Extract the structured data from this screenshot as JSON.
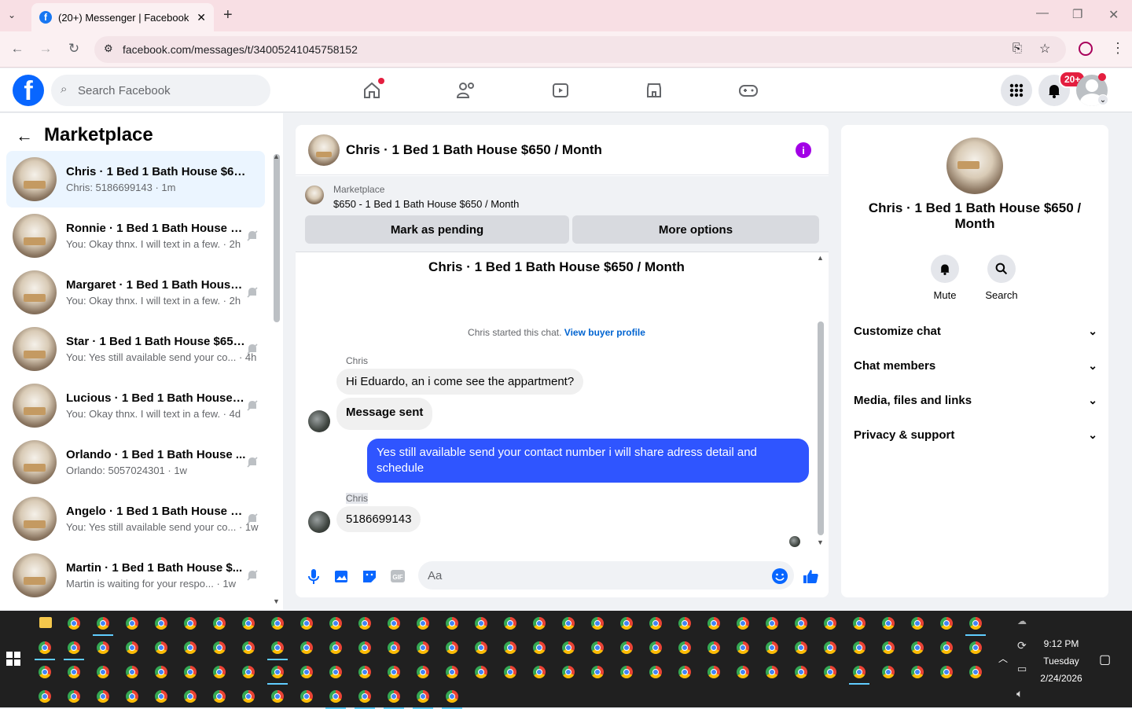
{
  "browser": {
    "tab_title": "(20+) Messenger | Facebook",
    "url": "facebook.com/messages/t/34005241045758152"
  },
  "fb": {
    "search_placeholder": "Search Facebook",
    "notif_badge": "20+"
  },
  "left": {
    "title": "Marketplace",
    "conversations": [
      {
        "name": "Chris · 1 Bed 1 Bath House $650 ...",
        "sub": "Chris: 5186699143 · 1m",
        "active": true
      },
      {
        "name": "Ronnie · 1 Bed 1 Bath House $...",
        "sub": "You: Okay thnx. I will text in a few. · 2h"
      },
      {
        "name": "Margaret · 1 Bed 1 Bath House...",
        "sub": "You: Okay thnx. I will text in a few. · 2h"
      },
      {
        "name": "Star · 1 Bed 1 Bath House $650 / ...",
        "sub": "You: Yes still available send your co... · 4h"
      },
      {
        "name": "Lucious · 1 Bed 1 Bath House $...",
        "sub": "You: Okay thnx. I will text in a few. · 4d"
      },
      {
        "name": "Orlando · 1 Bed 1 Bath House ...",
        "sub": "Orlando: 5057024301 · 1w"
      },
      {
        "name": "Angelo · 1 Bed 1 Bath House $65...",
        "sub": "You: Yes still available send your co... · 1w"
      },
      {
        "name": "Martin · 1 Bed 1 Bath House $...",
        "sub": "Martin is waiting for your respo... · 1w"
      }
    ]
  },
  "chat": {
    "title": "Chris · 1 Bed 1 Bath House $650 / Month",
    "marketplace_label": "Marketplace",
    "listing": "$650 - 1 Bed 1 Bath House $650 / Month",
    "btn_pending": "Mark as pending",
    "btn_more": "More options",
    "thread_title": "Chris · 1 Bed 1 Bath House $650 / Month",
    "started": "Chris started this chat.",
    "view_profile": "View buyer profile",
    "messages": [
      {
        "sender": "Chris",
        "text": "Hi Eduardo,  an i come see the appartment?"
      },
      {
        "text": "Message sent"
      },
      {
        "text": "Yes still available send your contact number i will share adress detail and schedule"
      },
      {
        "sender": "Chris",
        "text": "5186699143"
      }
    ],
    "composer_placeholder": "Aa"
  },
  "right": {
    "name": "Chris · 1 Bed 1 Bath House $650 / Month",
    "mute": "Mute",
    "search": "Search",
    "sections": [
      "Customize chat",
      "Chat members",
      "Media, files and links",
      "Privacy & support"
    ]
  },
  "taskbar": {
    "time": "9:12 PM",
    "day": "Tuesday",
    "date": "2/24/2026"
  },
  "colors": {
    "fb_blue": "#0866ff",
    "my_bubble": "#2f55ff",
    "badge": "#e41e3f",
    "info": "#a200e6"
  }
}
